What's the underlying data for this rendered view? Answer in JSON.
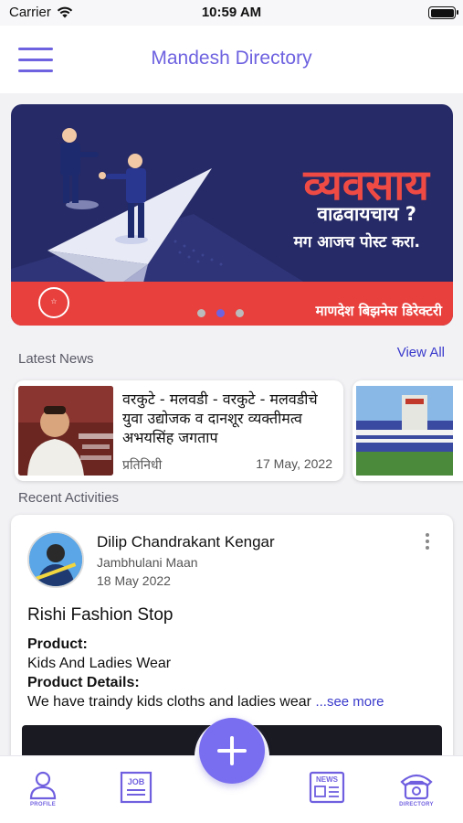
{
  "status_bar": {
    "carrier": "Carrier",
    "time": "10:59 AM"
  },
  "app_bar": {
    "title": "Mandesh Directory"
  },
  "banner": {
    "headline": "व्यवसाय",
    "subheadline": "वाढवायचाय ?",
    "tagline": "मग आजच पोस्ट करा.",
    "footer": "माणदेश बिझनेस डिरेक्टरी",
    "slides": 3,
    "active_slide": 2
  },
  "latest_news": {
    "label": "Latest News",
    "view_all": "View All",
    "items": [
      {
        "headline": "वरकुटे - मलवडी - वरकुटे - मलवडीचे युवा उद्योजक व दानशूर व्यक्तीमत्व अभयसिंह जगताप",
        "author": "प्रतिनिधी",
        "date": "17 May, 2022"
      }
    ]
  },
  "recent_activities": {
    "label": "Recent Activities",
    "post": {
      "user_name": "Dilip Chandrakant Kengar",
      "location": "Jambhulani Maan",
      "date": "18 May 2022",
      "title": "Rishi Fashion Stop",
      "product_label": "Product:",
      "product_value": "Kids And Ladies Wear",
      "details_label": "Product Details:",
      "details_value": "We have traindy kids cloths and ladies wear",
      "see_more": "...see more"
    }
  },
  "bottom_nav": {
    "items": [
      {
        "label": "PROFILE",
        "icon": "profile-icon"
      },
      {
        "label": "JOB",
        "icon": "job-icon"
      },
      {
        "label": "NEWS",
        "icon": "news-icon"
      },
      {
        "label": "DIRECTORY",
        "icon": "directory-icon"
      }
    ]
  },
  "colors": {
    "accent": "#6e62e0",
    "banner_bg": "#262a66",
    "banner_red": "#e8403c",
    "link": "#3a3acc"
  }
}
